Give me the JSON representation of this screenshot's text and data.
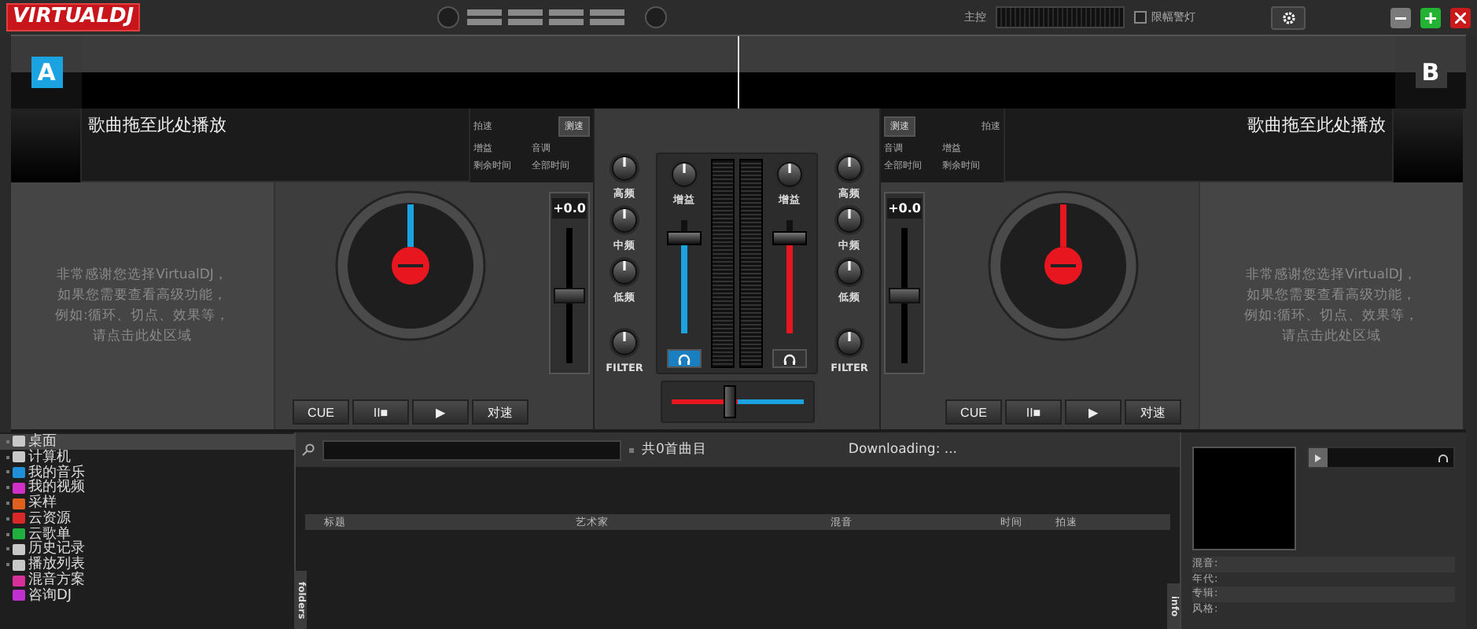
{
  "window": {
    "logo_main": "VIRTUAL",
    "logo_accent": "DJ",
    "master_label": "主控",
    "limiter": {
      "label": "限幅警灯",
      "checked": false
    }
  },
  "waveform": {
    "decks": [
      {
        "letter": "A",
        "color": "#1aa3e0"
      },
      {
        "letter": "B",
        "color": "#3a3a3a"
      }
    ]
  },
  "decks": [
    {
      "title": "歌曲拖至此处播放",
      "bpm_label": "拍速",
      "tap_button": "测速",
      "gain_label": "增益",
      "key_label": "音调",
      "remain_label": "剩余时间",
      "total_label": "全部时间",
      "message_lines": [
        "非常感谢您选择VirtualDJ，",
        "如果您需要查看高级功能，",
        "例如:循环、切点、效果等，",
        "请点击此处区域"
      ],
      "color": "#1aa3e0",
      "pitch": {
        "reading": "+0.0",
        "level": 0.5
      },
      "buttons": [
        "CUE",
        "II■",
        "▶",
        "对速"
      ]
    },
    {
      "title": "歌曲拖至此处播放",
      "bpm_label": "拍速",
      "tap_button": "测速",
      "gain_label": "增益",
      "key_label": "音调",
      "remain_label": "剩余时间",
      "total_label": "全部时间",
      "message_lines": [
        "非常感谢您选择VirtualDJ，",
        "如果您需要查看高级功能，",
        "例如:循环、切点、效果等，",
        "请点击此处区域"
      ],
      "color": "#e8171f",
      "pitch": {
        "reading": "+0.0",
        "level": 0.5
      },
      "buttons": [
        "CUE",
        "II■",
        "▶",
        "对速"
      ]
    }
  ],
  "mixer": {
    "channels": [
      {
        "eq": [
          {
            "label": "高频"
          },
          {
            "label": "中频"
          },
          {
            "label": "低频"
          },
          {
            "label": "FILTER"
          }
        ],
        "gain_label": "增益",
        "volume": {
          "level": 0.85
        },
        "color": "#1aa3e0",
        "pfl": true
      },
      {
        "eq": [
          {
            "label": "高频"
          },
          {
            "label": "中频"
          },
          {
            "label": "低频"
          },
          {
            "label": "FILTER"
          }
        ],
        "gain_label": "增益",
        "volume": {
          "level": 0.85
        },
        "color": "#e8171f",
        "pfl": false
      }
    ],
    "crossfader": {
      "level": 0.45
    }
  },
  "browser": {
    "tree": [
      {
        "label": "桌面",
        "color": "#c8c8c8",
        "selected": true,
        "expandable": true
      },
      {
        "label": "计算机",
        "color": "#c8c8c8",
        "selected": false,
        "expandable": true
      },
      {
        "label": "我的音乐",
        "color": "#1e8fd8",
        "selected": false,
        "expandable": true
      },
      {
        "label": "我的视频",
        "color": "#d030c8",
        "selected": false,
        "expandable": true
      },
      {
        "label": "采样",
        "color": "#e06020",
        "selected": false,
        "expandable": true
      },
      {
        "label": "云资源",
        "color": "#d82828",
        "selected": false,
        "expandable": true
      },
      {
        "label": "云歌单",
        "color": "#20b040",
        "selected": false,
        "expandable": true
      },
      {
        "label": "历史记录",
        "color": "#c8c8c8",
        "selected": false,
        "expandable": true
      },
      {
        "label": "播放列表",
        "color": "#c8c8c8",
        "selected": false,
        "expandable": true
      },
      {
        "label": "混音方案",
        "color": "#d8309a",
        "selected": false,
        "expandable": false
      },
      {
        "label": "咨询DJ",
        "color": "#c030d0",
        "selected": false,
        "expandable": false
      }
    ],
    "track_count": "共0首曲目",
    "status": "Downloading: ...",
    "columns": [
      "标题",
      "艺术家",
      "混音",
      "时间",
      "拍速"
    ],
    "folders_tab": "folders",
    "info_tab": "info",
    "info_fields": [
      "混音:",
      "年代:",
      "专辑:",
      "风格:"
    ]
  }
}
